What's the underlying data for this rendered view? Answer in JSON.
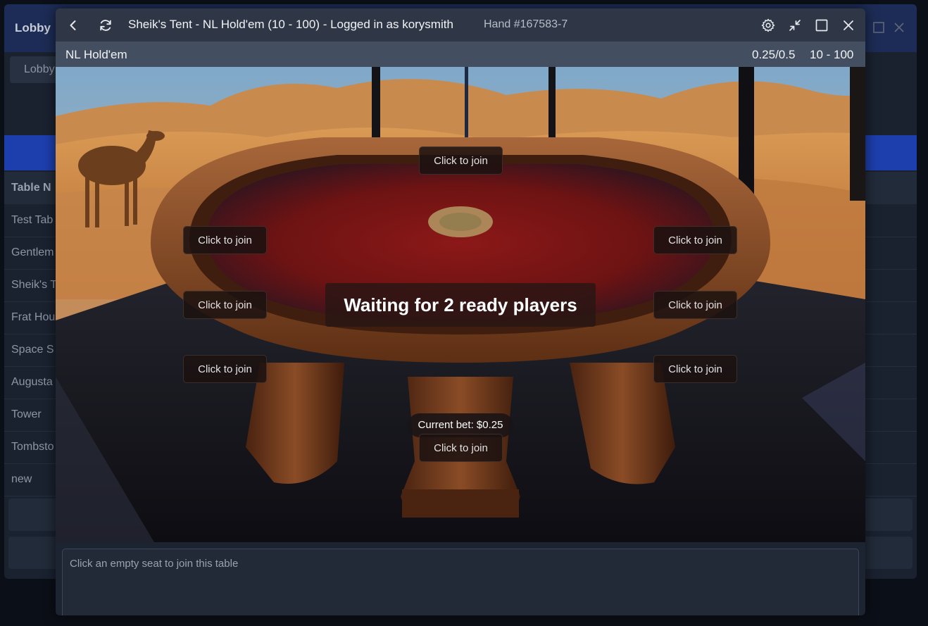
{
  "lobby": {
    "title": "Lobby",
    "tab": "Lobby",
    "column_header": "Table N",
    "rows": [
      "Test Tab",
      "Gentlem",
      "Sheik's T",
      "Frat Hou",
      "Space S",
      "Augusta",
      "Tower",
      "Tombsto",
      "new"
    ]
  },
  "window": {
    "title": "Sheik's Tent - NL Hold'em (10 - 100) - Logged in as korysmith",
    "hand": "Hand #167583-7"
  },
  "info": {
    "game_type": "NL Hold'em",
    "blinds": "0.25/0.5",
    "buyin": "10 - 100"
  },
  "table": {
    "status": "Waiting for 2 ready players",
    "current_bet": "Current bet: $0.25",
    "seats": [
      {
        "label": "Click to join"
      },
      {
        "label": "Click to join"
      },
      {
        "label": "Click to join"
      },
      {
        "label": "Click to join"
      },
      {
        "label": "Click to join"
      },
      {
        "label": "Click to join"
      },
      {
        "label": "Click to join"
      },
      {
        "label": "Click to join"
      }
    ]
  },
  "chat": {
    "placeholder": "Click an empty seat to join this table"
  },
  "icons": [
    "back-icon",
    "refresh-icon",
    "gear-icon",
    "collapse-icon",
    "maximize-icon",
    "close-icon"
  ]
}
